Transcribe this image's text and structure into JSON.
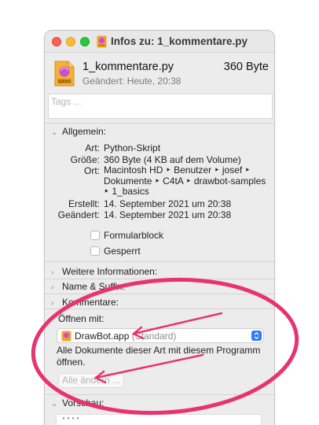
{
  "window": {
    "title": "Infos zu: 1_kommentare.py"
  },
  "file": {
    "name": "1_kommentare.py",
    "size": "360 Byte",
    "modified": "Geändert: Heute, 20:38",
    "icon": "python-file-icon",
    "icon_badge": "python"
  },
  "tags": {
    "placeholder": "Tags ..."
  },
  "general": {
    "header": "Allgemein:",
    "kind_label": "Art:",
    "kind_value": "Python-Skript",
    "size_label": "Größe:",
    "size_value": "360 Byte (4 KB auf dem Volume)",
    "where_label": "Ort:",
    "where_lines": [
      "Macintosh HD ‣ Benutzer ‣ josef ‣",
      "Dokumente ‣ C4tA ‣ drawbot-samples",
      "‣ 1_basics"
    ],
    "created_label": "Erstellt:",
    "created_value": "14. September 2021 um 20:38",
    "modified_label": "Geändert:",
    "modified_value": "14. September 2021 um 20:38",
    "stationery_label": "Formularblock",
    "locked_label": "Gesperrt"
  },
  "sections": {
    "more_info": "Weitere Informationen:",
    "name_ext": "Name & Suffix:",
    "comments": "Kommentare:",
    "open_with": "Öffnen mit:",
    "preview": "Vorschau:"
  },
  "open_with": {
    "app": "DrawBot.app",
    "default_suffix": "(Standard)",
    "description": "Alle Dokumente dieser Art mit diesem Programm öffnen.",
    "change_all_button": "Alle ändern ..."
  },
  "preview": {
    "text": "''''"
  },
  "colors": {
    "annotation": "#e8336e",
    "popup_accent": "#2f7cf6",
    "file_icon_bg": "#f0a22e",
    "file_icon_glyph": "#c64fd0"
  }
}
